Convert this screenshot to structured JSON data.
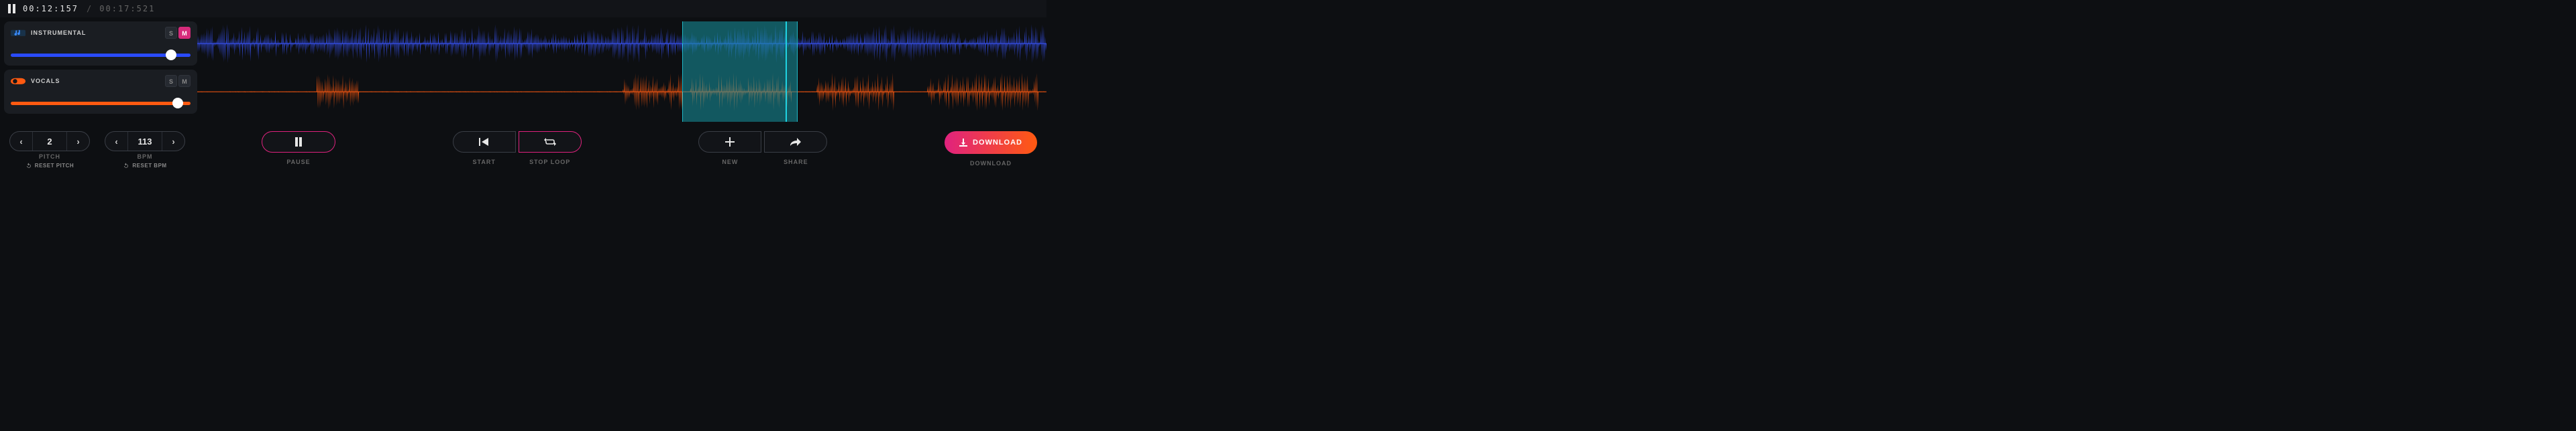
{
  "time": {
    "current": "00:12:157",
    "separator": "/",
    "total": "00:17:521"
  },
  "tracks": [
    {
      "id": "instrumental",
      "name": "INSTRUMENTAL",
      "color": "#3a55ff",
      "solo_active": false,
      "mute_active": true,
      "s_label": "S",
      "m_label": "M",
      "volume": 0.89,
      "icon": "music-note-icon"
    },
    {
      "id": "vocals",
      "name": "VOCALS",
      "color": "#ff5a11",
      "solo_active": false,
      "mute_active": false,
      "s_label": "S",
      "m_label": "M",
      "volume": 0.93,
      "icon": "mic-icon"
    }
  ],
  "loop": {
    "start_frac": 0.571,
    "end_frac": 0.707
  },
  "playhead_frac": 0.693,
  "controls": {
    "pitch": {
      "value": "2",
      "label": "PITCH",
      "reset": "RESET PITCH",
      "prev": "‹",
      "next": "›"
    },
    "bpm": {
      "value": "113",
      "label": "BPM",
      "reset": "RESET BPM",
      "prev": "‹",
      "next": "›"
    },
    "pause": {
      "label": "PAUSE"
    },
    "start": {
      "label": "START"
    },
    "stoploop": {
      "label": "STOP LOOP"
    },
    "new": {
      "label": "NEW"
    },
    "share": {
      "label": "SHARE"
    },
    "download": {
      "button": "DOWNLOAD",
      "label": "DOWNLOAD"
    }
  }
}
